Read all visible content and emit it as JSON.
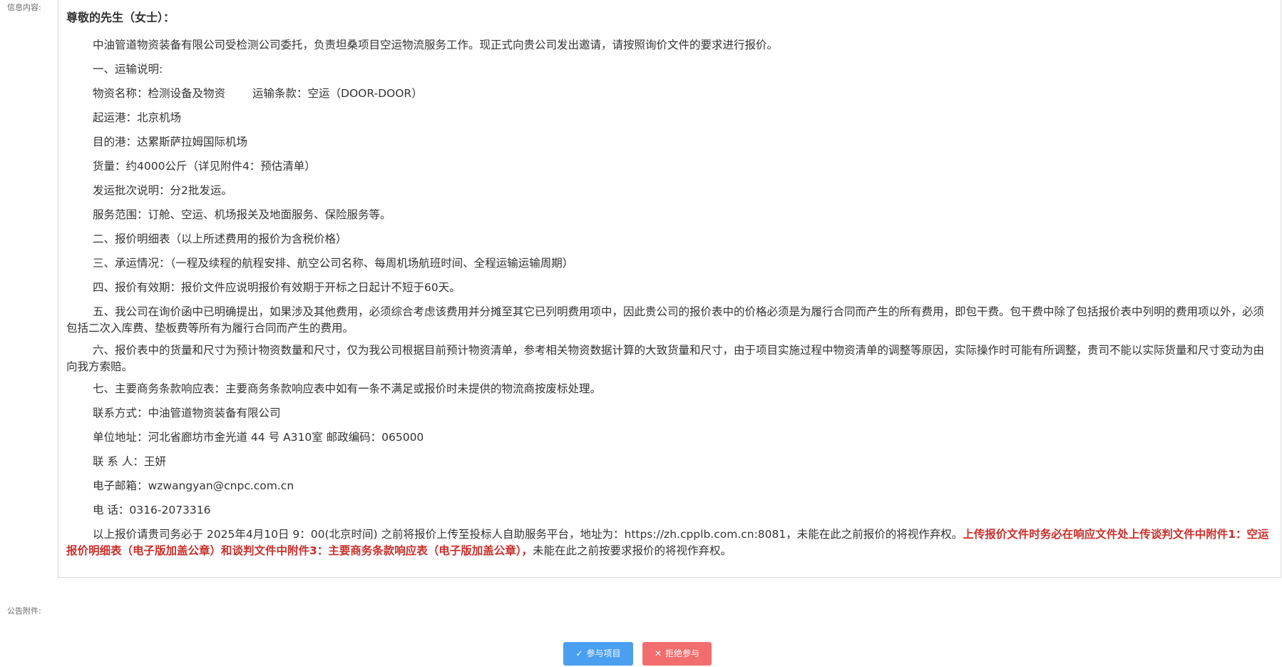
{
  "labels": {
    "info_content": "信息内容:",
    "attachments": "公告附件:"
  },
  "document": {
    "greeting": "尊敬的先生（女士）：",
    "intro": "中油管道物资装备有限公司受检测公司委托，负责坦桑项目空运物流服务工作。现正式向贵公司发出邀请，请按照询价文件的要求进行报价。",
    "section1_title": "一、运输说明:",
    "goods_name": "物资名称：检测设备及物资",
    "transport_terms": "运输条款：空运（DOOR-DOOR）",
    "origin": "起运港：北京机场",
    "destination": "目的港：达累斯萨拉姆国际机场",
    "volume": "货量：约4000公斤（详见附件4：预估清单）",
    "batches": "发运批次说明：分2批发运。",
    "scope": "服务范围：订舱、空运、机场报关及地面服务、保险服务等。",
    "section2": "二、报价明细表（以上所述费用的报价为含税价格）",
    "section3": "三、承运情况：（一程及续程的航程安排、航空公司名称、每周机场航班时间、全程运输运输周期）",
    "section4": "四、报价有效期：报价文件应说明报价有效期于开标之日起计不短于60天。",
    "section5": "五、我公司在询价函中已明确提出，如果涉及其他费用，必须综合考虑该费用并分摊至其它已列明费用项中，因此贵公司的报价表中的价格必须是为履行合同而产生的所有费用，即包干费。包干费中除了包括报价表中列明的费用项以外，必须包括二次入库费、垫板费等所有为履行合同而产生的费用。",
    "section6": "六、报价表中的货量和尺寸为预计物资数量和尺寸，仅为我公司根据目前预计物资清单，参考相关物资数据计算的大致货量和尺寸，由于项目实施过程中物资清单的调整等原因，实际操作时可能有所调整，贵司不能以实际货量和尺寸变动为由向我方索赔。",
    "section7": "七、主要商务条款响应表：主要商务条款响应表中如有一条不满足或报价时未提供的物流商按废标处理。",
    "contact": "联系方式：中油管道物资装备有限公司",
    "address": "单位地址：河北省廊坊市金光道 44 号 A310室 邮政编码：065000",
    "contact_person": "联 系 人：王妍",
    "email": "电子邮箱：wzwangyan@cnpc.com.cn",
    "phone": "电 话：0316-2073316",
    "deadline_text": "以上报价请贵司务必于 2025年4月10日 9：00(北京时间) 之前将报价上传至投标人自助服务平台，地址为：https://zh.cpplb.com.cn:8081，未能在此之前报价的将视作弃权。",
    "deadline_red": "上传报价文件时务必在响应文件处上传谈判文件中附件1：空运报价明细表（电子版加盖公章）和谈判文件中附件3：主要商务条款响应表（电子版加盖公章），",
    "deadline_tail": "未能在此之前按要求报价的将视作弃权。"
  },
  "buttons": {
    "join_icon": "✓",
    "join_label": "参与项目",
    "reject_icon": "✕",
    "reject_label": "拒绝参与"
  },
  "colors": {
    "join_button": "#4a9ff0",
    "reject_button": "#f26d6d",
    "red_emphasis": "#c9302c"
  }
}
